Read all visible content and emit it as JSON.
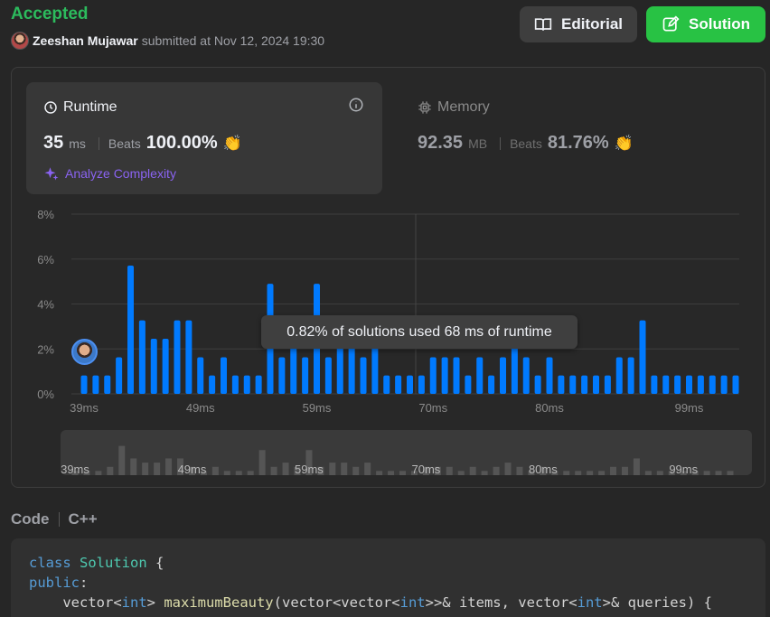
{
  "header": {
    "status": "Accepted",
    "user": "Zeeshan Mujawar",
    "submitted_text": "submitted at Nov 12, 2024 19:30"
  },
  "buttons": {
    "editorial": "Editorial",
    "solution": "Solution"
  },
  "runtime": {
    "title": "Runtime",
    "value": "35",
    "unit": "ms",
    "beats_label": "Beats",
    "beats_value": "100.00%",
    "analyze": "Analyze Complexity"
  },
  "memory": {
    "title": "Memory",
    "value": "92.35",
    "unit": "MB",
    "beats_label": "Beats",
    "beats_value": "81.76%"
  },
  "tooltip": "0.82% of solutions used 68 ms of runtime",
  "chart_data": {
    "type": "bar",
    "y_ticks": [
      "8%",
      "6%",
      "4%",
      "2%",
      "0%"
    ],
    "ylim": [
      0,
      8
    ],
    "x_ticks": [
      "39ms",
      "49ms",
      "59ms",
      "70ms",
      "80ms",
      "99ms"
    ],
    "values": [
      0.82,
      0.82,
      0.82,
      1.63,
      5.71,
      3.27,
      2.45,
      2.45,
      3.27,
      3.27,
      1.63,
      0.82,
      1.63,
      0.82,
      0.82,
      0.82,
      4.9,
      1.63,
      2.45,
      1.63,
      4.9,
      1.63,
      2.45,
      2.45,
      1.63,
      2.45,
      0.82,
      0.82,
      0.82,
      0.82,
      1.63,
      1.63,
      1.63,
      0.82,
      1.63,
      0.82,
      1.63,
      2.45,
      1.63,
      0.82,
      1.63,
      0.82,
      0.82,
      0.82,
      0.82,
      0.82,
      1.63,
      1.63,
      3.27,
      0.82,
      0.82,
      0.82,
      0.82,
      0.82,
      0.82,
      0.82,
      0.82
    ],
    "bar_color": "#007aff",
    "overview_color": "#555555"
  },
  "code_section": {
    "label": "Code",
    "language": "C++"
  },
  "code_lines": [
    "class Solution {",
    "public:",
    "    vector<int> maximumBeauty(vector<vector<int>>& items, vector<int>& queries) {"
  ]
}
